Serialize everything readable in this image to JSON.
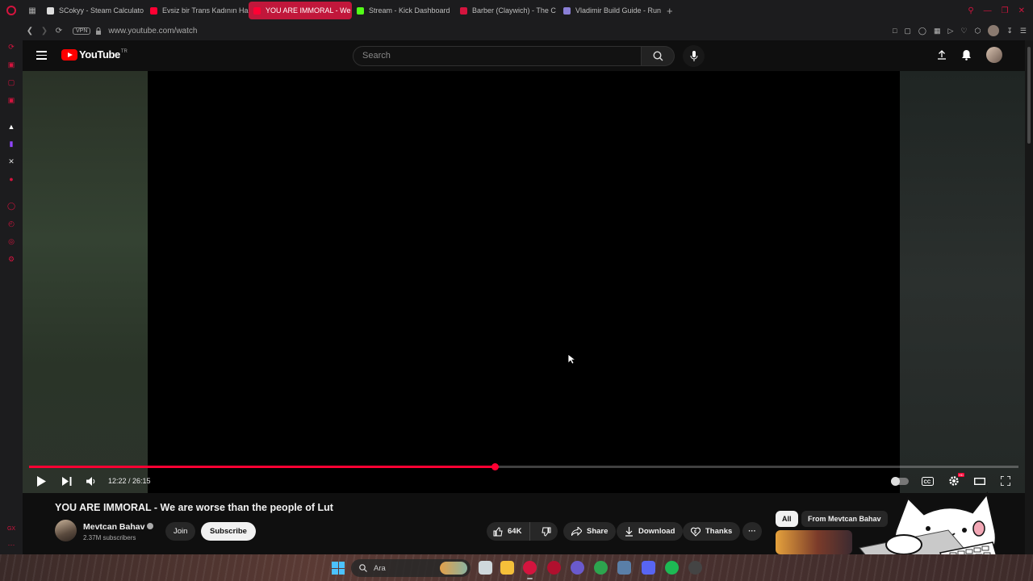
{
  "browser": {
    "tabs": [
      {
        "label": "SCokyy - Steam Calculato",
        "icon_color": "#dddddd",
        "active": false
      },
      {
        "label": "Evsiz bir Trans Kadının Ha",
        "icon_color": "#ff0033",
        "active": false
      },
      {
        "label": "YOU ARE IMMORAL - We",
        "icon_color": "#ff0033",
        "active": true
      },
      {
        "label": "Stream - Kick Dashboard",
        "icon_color": "#53fc18",
        "active": false
      },
      {
        "label": "Barber (Claywich) - The C",
        "icon_color": "#d4143e",
        "active": false
      },
      {
        "label": "Vladimir Build Guide - Run",
        "icon_color": "#8a7fd6",
        "active": false
      }
    ],
    "vpn_label": "VPN",
    "url": "www.youtube.com/watch",
    "accent_color": "#d4143e"
  },
  "youtube": {
    "logo_text": "YouTube",
    "country_code": "TR",
    "search_placeholder": "Search"
  },
  "player": {
    "current_time": "12:22",
    "duration": "26:15",
    "time_display": "12:22 / 26:15",
    "progress_fraction": 0.471,
    "progress_color": "#ff0033"
  },
  "video": {
    "title": "YOU ARE IMMORAL - We are worse than the people of Lut",
    "channel_name": "Mevtcan Bahav",
    "subscribers": "2.37M subscribers",
    "join_label": "Join",
    "subscribe_label": "Subscribe",
    "likes": "64K",
    "share_label": "Share",
    "download_label": "Download",
    "thanks_label": "Thanks",
    "more_label": "···"
  },
  "recommendations": {
    "chips": [
      "All",
      "From Mevtcan Bahav"
    ]
  },
  "taskbar": {
    "search_placeholder": "Ara"
  }
}
